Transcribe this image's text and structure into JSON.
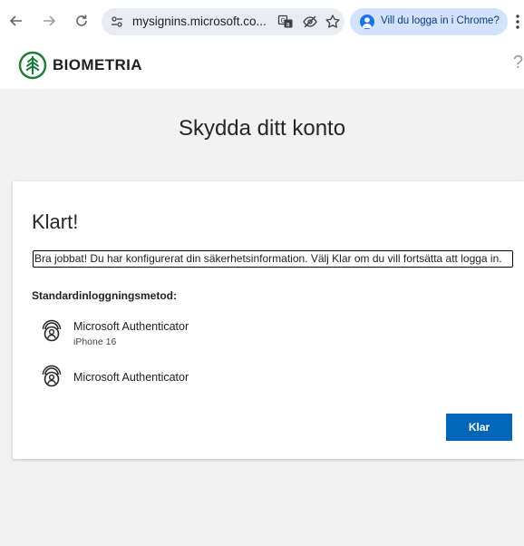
{
  "browser": {
    "url": "mysignins.microsoft.co...",
    "profile_prompt": "Vill du logga in i Chrome?",
    "icons": [
      "back-icon",
      "forward-icon",
      "reload-icon",
      "site-settings-icon",
      "translate-icon",
      "tracking-protection-icon",
      "bookmark-star-icon",
      "profile-avatar-icon",
      "more-menu-icon"
    ]
  },
  "header": {
    "brand": "BIOMETRIA",
    "help": "?"
  },
  "page": {
    "title": "Skydda ditt konto"
  },
  "card": {
    "heading": "Klart!",
    "message": "Bra jobbat! Du har konfigurerat din säkerhetsinformation. Välj Klar om du vill fortsätta att logga in.",
    "default_method_label": "Standardinloggningsmetod:",
    "methods": [
      {
        "name": "Microsoft Authenticator",
        "device": "iPhone 16"
      },
      {
        "name": "Microsoft Authenticator",
        "device": ""
      }
    ],
    "done_button": "Klar"
  },
  "colors": {
    "primary_button": "#0067b8",
    "brand_green": "#1f7a3a",
    "profile_chip": "#d3e3fd"
  }
}
